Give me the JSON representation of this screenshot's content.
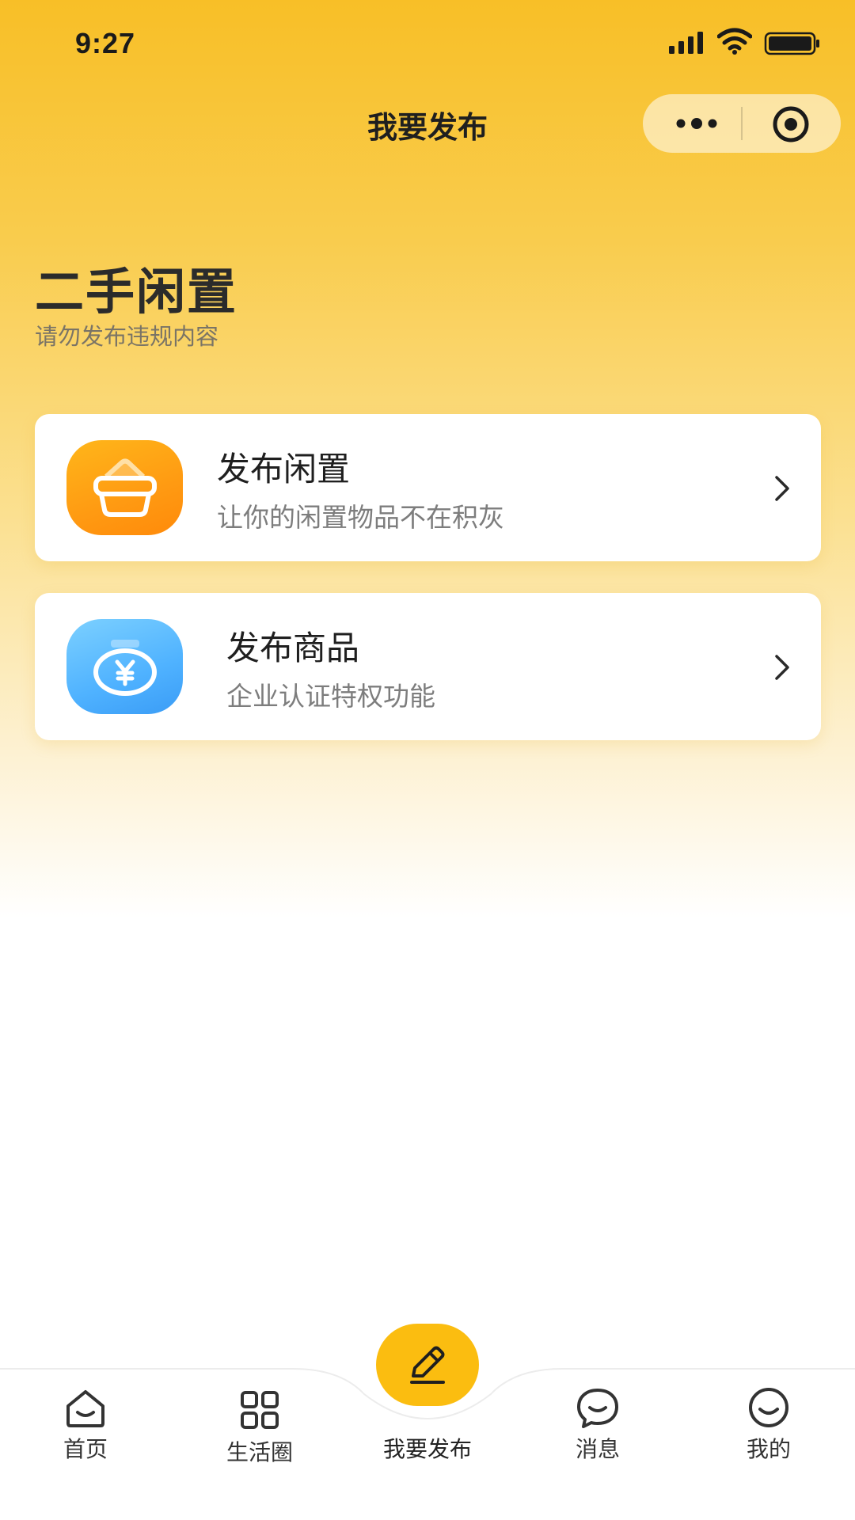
{
  "status_bar": {
    "time": "9:27"
  },
  "nav": {
    "title": "我要发布"
  },
  "header": {
    "title": "二手闲置",
    "subtitle": "请勿发布违规内容"
  },
  "cards": [
    {
      "title": "发布闲置",
      "subtitle": "让你的闲置物品不在积灰",
      "icon": "basket-icon",
      "color": "#ff9a12"
    },
    {
      "title": "发布商品",
      "subtitle": "企业认证特权功能",
      "icon": "money-bag-icon",
      "color": "#4fb2ff"
    }
  ],
  "tab_bar": {
    "items": [
      {
        "label": "首页",
        "icon": "home-icon"
      },
      {
        "label": "生活圈",
        "icon": "grid-icon"
      },
      {
        "label": "我要发布",
        "icon": "pencil-icon",
        "active": true
      },
      {
        "label": "消息",
        "icon": "chat-icon"
      },
      {
        "label": "我的",
        "icon": "smile-icon"
      }
    ]
  },
  "colors": {
    "accent": "#fbbd10",
    "background_top": "#f8bf27"
  }
}
